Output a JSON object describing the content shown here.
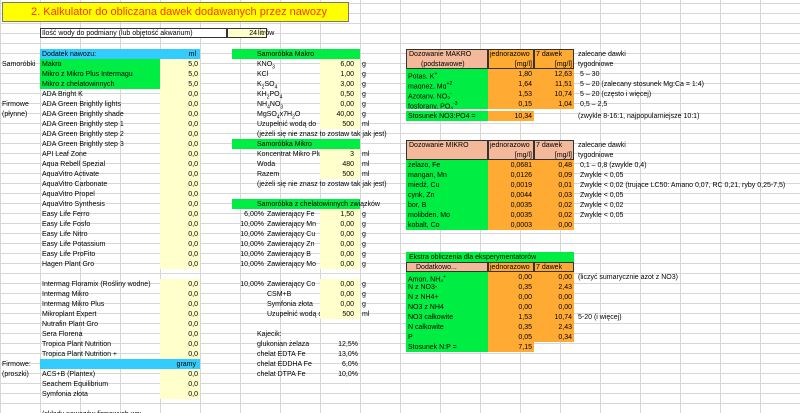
{
  "title": "2. Kalkulator do obliczana dawek dodawanych przez nawozy",
  "volume": {
    "label": "Ilość wody do podmiany (lub objętość akwarium)",
    "value": "24",
    "unit": "litrów"
  },
  "fert": {
    "header": "Dodatek nawozu:",
    "unit": "ml",
    "unit_g": "gramy",
    "sections": [
      {
        "label": "Samoróbki"
      },
      {
        "label": "Firmowe"
      },
      {
        "label": "(płynne)"
      },
      {
        "label": "Firmowe:"
      },
      {
        "label": "(proszki)"
      }
    ],
    "homemade": [
      {
        "name": "Makro",
        "value": "5,0"
      },
      {
        "name": "Mikro z Mikro Plus Intermagu",
        "value": "5,0"
      },
      {
        "name": "Mikro z chelatowinnych",
        "value": "5,0"
      }
    ],
    "liquid": [
      {
        "name": "ADA Bright K",
        "value": "0,0"
      },
      {
        "name": "ADA Green Brightly lights",
        "value": "0,0"
      },
      {
        "name": "ADA Green Brightly shade",
        "value": "0,0"
      },
      {
        "name": "ADA Green Brightly step 1",
        "value": "0,0"
      },
      {
        "name": "ADA Green Brightly step 2",
        "value": "0,0"
      },
      {
        "name": "ADA Green Brightly step 3",
        "value": "0,0"
      },
      {
        "name": "API Leaf Zone",
        "value": "0,0"
      },
      {
        "name": "Aqua Rebell Spezial",
        "value": "0,0"
      },
      {
        "name": "AquaVitro Activate",
        "value": "0,0"
      },
      {
        "name": "AquaVitro Carbonate",
        "value": "0,0"
      },
      {
        "name": "AquaVitro Propel",
        "value": "0,0"
      },
      {
        "name": "AquaVitro Synthesis",
        "value": "0,0"
      },
      {
        "name": "Easy Life Ferro",
        "value": "0,0"
      },
      {
        "name": "Easy Life Fosfo",
        "value": "0,0"
      },
      {
        "name": "Easy Life Nitro",
        "value": "0,0"
      },
      {
        "name": "Easy Life Potassium",
        "value": "0,0"
      },
      {
        "name": "Easy Life ProFito",
        "value": "0,0"
      },
      {
        "name": "Hagen Plant Gro",
        "value": "0,0"
      },
      {
        "name": "Intermag Floramix (Rośliny wodne)",
        "value": "0,0"
      },
      {
        "name": "Intermag Mikro",
        "value": "0,0"
      },
      {
        "name": "Intermag Mikro Plus",
        "value": "0,0"
      },
      {
        "name": "Mikroplant Expert",
        "value": "0,0"
      },
      {
        "name": "Nutrafin Plant Gro",
        "value": "0,0"
      },
      {
        "name": "Sera Florena",
        "value": "0,0"
      },
      {
        "name": "Tropica Plant Nutrition",
        "value": "0,0"
      },
      {
        "name": "Tropica Plant Nutrition +",
        "value": "0,0"
      }
    ],
    "powder": [
      {
        "name": "ACS+B (Plantex)",
        "value": "0,0"
      },
      {
        "name": "Seachem Equilibrium",
        "value": "0,0"
      },
      {
        "name": "Symfonia złota",
        "value": "0,0"
      }
    ],
    "footer": "(składy nawozów firmowych wg:"
  },
  "makro": {
    "header": "Samoróbka Makro",
    "rows": [
      {
        "n": "KNO",
        "s": "3",
        "v": "6,00",
        "u": "g"
      },
      {
        "n": "KCl",
        "s": "",
        "v": "1,00",
        "u": "g"
      },
      {
        "n": "K",
        "s": "2",
        "n2": "SO",
        "s2": "4",
        "v": "3,00",
        "u": "g"
      },
      {
        "n": "KH",
        "s": "2",
        "n2": "PO",
        "s2": "4",
        "v": "0,50",
        "u": "g"
      },
      {
        "n": "NH",
        "s": "4",
        "n2": "NO",
        "s2": "3",
        "v": "0,00",
        "u": "g"
      },
      {
        "n": "MgSO",
        "s": "4",
        "n2": "x7H",
        "s2": "2",
        "n3": "O",
        "v": "40,00",
        "u": "g"
      }
    ],
    "water": {
      "label": "Uzupełnić wodą do",
      "v": "500",
      "u": "ml"
    },
    "note": "(jeżeli się nie znasz to zostaw tak jak jest)"
  },
  "mikro": {
    "header": "Samoróbka Mikro",
    "rows": [
      {
        "n": "Koncentrat Mikro Plus",
        "v": "3",
        "u": "ml"
      },
      {
        "n": "Woda",
        "v": "480",
        "u": "ml"
      },
      {
        "n": "Razem",
        "v": "500",
        "u": "ml"
      }
    ],
    "note": "(jeżeli się nie znasz to zostaw tak jak jest)"
  },
  "chel": {
    "header": "Samoróbka z chelatowinnych związków",
    "rows": [
      {
        "p": "6,00%",
        "n": "Zawierający Fe",
        "v": "1,50",
        "u": "g"
      },
      {
        "p": "10,00%",
        "n": "Zawierający Mn",
        "v": "0,00",
        "u": "g"
      },
      {
        "p": "10,00%",
        "n": "Zawierający Cu",
        "v": "0,00",
        "u": "g"
      },
      {
        "p": "10,00%",
        "n": "Zawierający Zn",
        "v": "0,00",
        "u": "g"
      },
      {
        "p": "10,00%",
        "n": "Zawierający B",
        "v": "0,00",
        "u": "g"
      },
      {
        "p": "10,00%",
        "n": "Zawierający Mo",
        "v": "0,00",
        "u": "g"
      },
      {
        "p": "",
        "n": "",
        "v": "",
        "u": ""
      },
      {
        "p": "10,00%",
        "n": "Zawierający Co",
        "v": "0,00",
        "u": "g"
      },
      {
        "p": "",
        "n": "CSM+B",
        "v": "0,00",
        "u": "g"
      },
      {
        "p": "",
        "n": "Symfonia złota",
        "v": "0,00",
        "u": "g"
      },
      {
        "p": "",
        "n": "Uzupełnić wodą do",
        "v": "500",
        "u": "ml"
      }
    ],
    "kaj": {
      "label": "Kajecik:",
      "rows": [
        {
          "n": "glukonian żelaza",
          "v": "12,5%"
        },
        {
          "n": "chelat EDTA Fe",
          "v": "13,0%"
        },
        {
          "n": "chelat EDDHA Fe",
          "v": "6,0%"
        },
        {
          "n": "chelat DTPA Fe",
          "v": "10,0%"
        }
      ]
    }
  },
  "dmakro": {
    "h1": "Dozowanie MAKRO",
    "h2": "(podstawowe)",
    "c1": "jednorazowo",
    "c2": "7 dawek",
    "u1": "[mg/l]",
    "u2": "[mg/l]",
    "rec": "zalecane dawki",
    "rec2": "tygodniowe",
    "rows": [
      {
        "n": "Potas, K",
        "sup": "+",
        "a": "1,80",
        "b": "12,63",
        "r": "5 – 30"
      },
      {
        "n": "magnez, Mg",
        "sup": "+2",
        "a": "1,64",
        "b": "11,51",
        "r": "5 – 20 (zalecany stosunek Mg:Ca = 1:4)"
      },
      {
        "n": "Azotany, NO",
        "sub": "3",
        "sup": "-",
        "a": "1,53",
        "b": "10,74",
        "r": "5 – 20 (często i więcej)"
      },
      {
        "n": "fosforany, PO",
        "sub": "4",
        "sup": "-3",
        "a": "0,15",
        "b": "1,04",
        "r": "0,5 – 2,5"
      }
    ],
    "ratio": {
      "l": "Stosunek NO3:PO4 =",
      "v": "10,34",
      "r": "(zwykle 8-16:1, najpopularniejsze 10:1)"
    }
  },
  "dmikro": {
    "h1": "Dozowanie MIKRO",
    "c1": "jednorazowo",
    "c2": "7 dawek",
    "u1": "[mg/l]",
    "u2": "[mg/l]",
    "rec": "zalecane dawki",
    "rec2": "tygodniowe",
    "rows": [
      {
        "n": "żelazo, Fe",
        "a": "0,0681",
        "b": "0,48",
        "r": "0,1 – 0,8 (zwykle 0,4)"
      },
      {
        "n": "mangan, Mn",
        "a": "0,0126",
        "b": "0,09",
        "r": "Zwykle < 0,05"
      },
      {
        "n": "miedź, Cu",
        "a": "0,0019",
        "b": "0,01",
        "r": "Zwykle < 0,02 (trujące LC50: Amano 0,07, RC 0,21, ryby 0,25-7,5)"
      },
      {
        "n": "cynk, Zn",
        "a": "0,0044",
        "b": "0,03",
        "r": "Zwykle < 0,05"
      },
      {
        "n": "bor, B",
        "a": "0,0035",
        "b": "0,02",
        "r": "Zwykle < 0,02"
      },
      {
        "n": "molibden, Mo",
        "a": "0,0035",
        "b": "0,02",
        "r": "Zwykle < 0,05"
      },
      {
        "n": "kobalt, Co",
        "a": "0,0003",
        "b": "0,00",
        "r": ""
      }
    ]
  },
  "extra": {
    "h": "Ekstra obliczenia dla eksperymentatorów",
    "c0": "Dodatkowo...",
    "c1": "jednorazowo",
    "c2": "7 dawek",
    "rows": [
      {
        "n": "Amon, NH",
        "sub": "4",
        "sup": "+",
        "a": "0,00",
        "b": "0,00",
        "r": "(liczyć sumarycznie azot z NO3)"
      },
      {
        "n": "N z NO3-",
        "a": "0,35",
        "b": "2,43",
        "r": ""
      },
      {
        "n": "N z NH4+",
        "a": "0,00",
        "b": "0,00",
        "r": ""
      },
      {
        "n": "NO3 z NH4",
        "a": "0,00",
        "b": "0,00",
        "r": ""
      },
      {
        "n": "NO3 całkowite",
        "a": "1,53",
        "b": "10,74",
        "r": "5-20 (i więcej)"
      },
      {
        "n": "N całkowite",
        "a": "0,35",
        "b": "2,43",
        "r": ""
      },
      {
        "n": "P",
        "a": "0,05",
        "b": "0,34",
        "r": ""
      }
    ],
    "ratio": {
      "l": "Stosunek N:P =",
      "v": "7,15"
    }
  },
  "colors": {
    "title_bg": "#ffff00",
    "title_text": "#ff3300",
    "blue": "#33ccff",
    "green": "#00ee44",
    "cream": "#ffffcc",
    "orange": "#ffaa33",
    "salmon": "#f4b89a"
  }
}
